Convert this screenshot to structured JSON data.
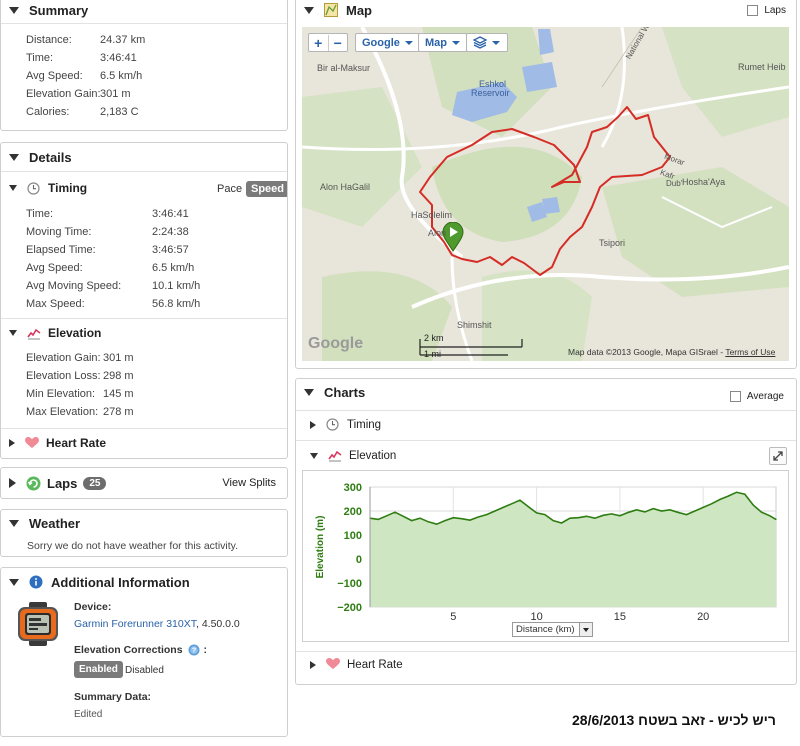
{
  "summary": {
    "title": "Summary",
    "rows": [
      {
        "label": "Distance:",
        "value": "24.37 km"
      },
      {
        "label": "Time:",
        "value": "3:46:41"
      },
      {
        "label": "Avg Speed:",
        "value": "6.5 km/h"
      },
      {
        "label": "Elevation Gain:",
        "value": "301 m"
      },
      {
        "label": "Calories:",
        "value": "2,183 C"
      }
    ]
  },
  "details": {
    "title": "Details",
    "timing": {
      "title": "Timing",
      "pace_label": "Pace",
      "speed_label": "Speed",
      "rows": [
        {
          "label": "Time:",
          "value": "3:46:41"
        },
        {
          "label": "Moving Time:",
          "value": "2:24:38"
        },
        {
          "label": "Elapsed Time:",
          "value": "3:46:57"
        },
        {
          "label": "Avg Speed:",
          "value": "6.5 km/h"
        },
        {
          "label": "Avg Moving Speed:",
          "value": "10.1 km/h"
        },
        {
          "label": "Max Speed:",
          "value": "56.8 km/h"
        }
      ]
    },
    "elevation": {
      "title": "Elevation",
      "rows": [
        {
          "label": "Elevation Gain:",
          "value": "301 m"
        },
        {
          "label": "Elevation Loss:",
          "value": "298 m"
        },
        {
          "label": "Min Elevation:",
          "value": "145 m"
        },
        {
          "label": "Max Elevation:",
          "value": "278 m"
        }
      ]
    },
    "heart_rate": {
      "title": "Heart Rate"
    }
  },
  "laps": {
    "title": "Laps",
    "count": "25",
    "view_splits": "View Splits"
  },
  "weather": {
    "title": "Weather",
    "message": "Sorry we do not have weather for this activity."
  },
  "additional": {
    "title": "Additional Information",
    "device_label": "Device:",
    "device_name": "Garmin Forerunner 310XT",
    "device_version": ", 4.50.0.0",
    "elev_corr_label": "Elevation Corrections",
    "enabled": "Enabled",
    "disabled": "Disabled",
    "summary_data_label": "Summary Data:",
    "summary_data_value": "Edited"
  },
  "map": {
    "title": "Map",
    "laps_label": "Laps",
    "zoom_in": "+",
    "zoom_out": "−",
    "provider": "Google",
    "type": "Map",
    "places": [
      "Bir al-Maksur",
      "Eshkol",
      "Reservoir",
      "Rumet Heib",
      "Alon HaGalil",
      "HaSolelim",
      "Alon",
      "Hosha'Aya",
      "Tsipori",
      "Shimshit",
      "National W",
      "Kafr",
      "Dub'",
      "Morar",
      "Tsipori"
    ],
    "scale_km": "2 km",
    "scale_mi": "1 mi",
    "attribution": "Map data ©2013 Google, Mapa GISrael -",
    "terms": "Terms of Use",
    "google_logo": "Google"
  },
  "charts": {
    "title": "Charts",
    "average_label": "Average",
    "timing": "Timing",
    "elevation": "Elevation",
    "heart_rate": "Heart Rate",
    "x_select": "Distance (km)"
  },
  "chart_data": {
    "type": "area",
    "ylabel": "Elevation (m)",
    "xlabel": "Distance (km)",
    "ylim": [
      -200,
      300
    ],
    "xlim": [
      0,
      24.37
    ],
    "yticks": [
      300,
      200,
      100,
      0,
      -100,
      -200
    ],
    "ytick_labels": [
      "300",
      "200",
      "100",
      "0",
      "−100",
      "−200"
    ],
    "xticks": [
      5,
      10,
      15,
      20
    ],
    "grid": true,
    "color": "#2e7d12",
    "fill": "#cfe6c2",
    "x": [
      0,
      0.5,
      1,
      1.5,
      2,
      2.5,
      3,
      3.5,
      4,
      4.5,
      5,
      5.5,
      6,
      6.5,
      7,
      7.5,
      8,
      8.5,
      9,
      9.5,
      10,
      10.5,
      11,
      11.5,
      12,
      12.5,
      13,
      13.5,
      14,
      14.5,
      15,
      15.5,
      16,
      16.5,
      17,
      17.5,
      18,
      18.5,
      19,
      19.5,
      20,
      20.5,
      21,
      21.5,
      22,
      22.5,
      23,
      23.5,
      24,
      24.37
    ],
    "y": [
      170,
      165,
      180,
      195,
      178,
      160,
      170,
      155,
      145,
      160,
      172,
      168,
      162,
      175,
      185,
      200,
      215,
      230,
      245,
      218,
      192,
      185,
      160,
      150,
      170,
      172,
      178,
      170,
      182,
      188,
      180,
      194,
      205,
      196,
      210,
      200,
      205,
      194,
      185,
      200,
      215,
      230,
      248,
      262,
      278,
      270,
      225,
      195,
      180,
      165
    ]
  },
  "footer": {
    "text": "ריש לכיש - זאב בשטח 28/6/2013"
  }
}
